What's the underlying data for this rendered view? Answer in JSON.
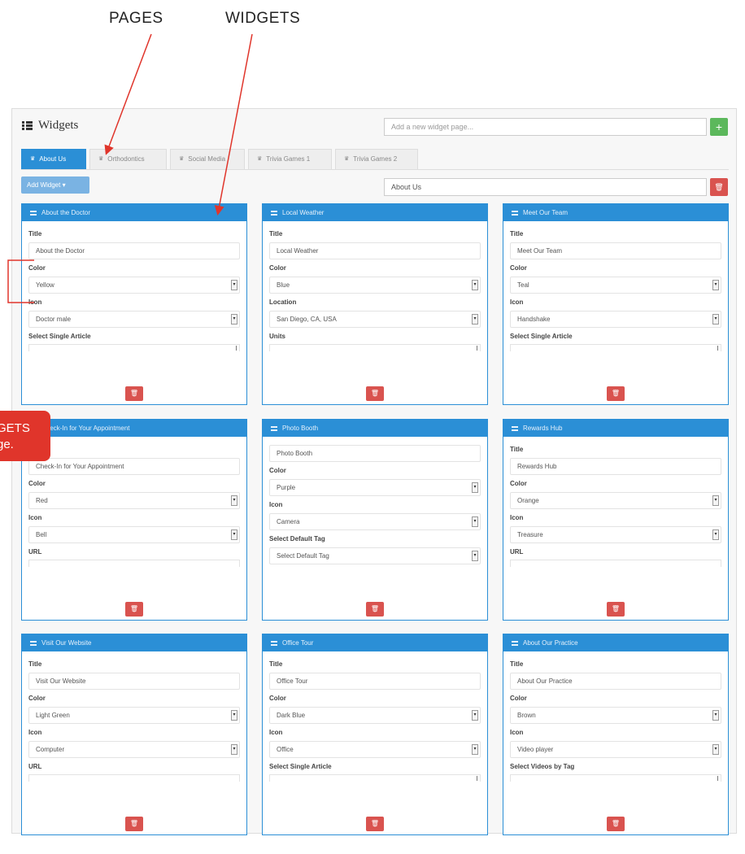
{
  "annotations": {
    "pages_label": "PAGES",
    "widgets_label": "WIDGETS",
    "callout_text": "GETS\nge."
  },
  "header": {
    "title": "Widgets",
    "new_page_placeholder": "Add a new widget page...",
    "add_label": "+"
  },
  "tabs": [
    {
      "label": "About Us",
      "active": true
    },
    {
      "label": "Orthodontics",
      "active": false
    },
    {
      "label": "Social Media",
      "active": false
    },
    {
      "label": "Trivia Games 1",
      "active": false
    },
    {
      "label": "Trivia Games 2",
      "active": false
    }
  ],
  "toolbar": {
    "add_widget_label": "Add Widget ▾",
    "page_name_value": "About Us",
    "delete_label": "🗑"
  },
  "widgets": [
    {
      "header": "About the Doctor",
      "title_label": "Title",
      "title_value": "About the Doctor",
      "f1_label": "Color",
      "f1_value": "Yellow",
      "f2_label": "Icon",
      "f2_value": "Doctor male",
      "f3_label": "Select Single Article"
    },
    {
      "header": "Local Weather",
      "title_label": "Title",
      "title_value": "Local Weather",
      "f1_label": "Color",
      "f1_value": "Blue",
      "f2_label": "Location",
      "f2_value": "San Diego, CA, USA",
      "f3_label": "Units"
    },
    {
      "header": "Meet Our Team",
      "title_label": "Title",
      "title_value": "Meet Our Team",
      "f1_label": "Color",
      "f1_value": "Teal",
      "f2_label": "Icon",
      "f2_value": "Handshake",
      "f3_label": "Select Single Article"
    },
    {
      "header": "Check-In for Your Appointment",
      "title_label": "",
      "title_value": "Check-In for Your Appointment",
      "f1_label": "Color",
      "f1_value": "Red",
      "f2_label": "Icon",
      "f2_value": "Bell",
      "f3_label": "URL"
    },
    {
      "header": "Photo Booth",
      "title_label": "",
      "title_value": "Photo Booth",
      "f1_label": "Color",
      "f1_value": "Purple",
      "f2_label": "Icon",
      "f2_value": "Camera",
      "f3_label": "Select Default Tag",
      "f3_value": "Select Default Tag"
    },
    {
      "header": "Rewards Hub",
      "title_label": "Title",
      "title_value": "Rewards Hub",
      "f1_label": "Color",
      "f1_value": "Orange",
      "f2_label": "Icon",
      "f2_value": "Treasure",
      "f3_label": "URL"
    },
    {
      "header": "Visit Our Website",
      "title_label": "Title",
      "title_value": "Visit Our Website",
      "f1_label": "Color",
      "f1_value": "Light Green",
      "f2_label": "Icon",
      "f2_value": "Computer",
      "f3_label": "URL"
    },
    {
      "header": "Office Tour",
      "title_label": "Title",
      "title_value": "Office Tour",
      "f1_label": "Color",
      "f1_value": "Dark Blue",
      "f2_label": "Icon",
      "f2_value": "Office",
      "f3_label": "Select Single Article"
    },
    {
      "header": "About Our Practice",
      "title_label": "Title",
      "title_value": "About Our Practice",
      "f1_label": "Color",
      "f1_value": "Brown",
      "f2_label": "Icon",
      "f2_value": "Video player",
      "f3_label": "Select Videos by Tag"
    }
  ],
  "colors": {
    "primary": "#2b8fd6",
    "success": "#5cb85c",
    "danger": "#d9534f",
    "annotation": "#e0352b"
  }
}
